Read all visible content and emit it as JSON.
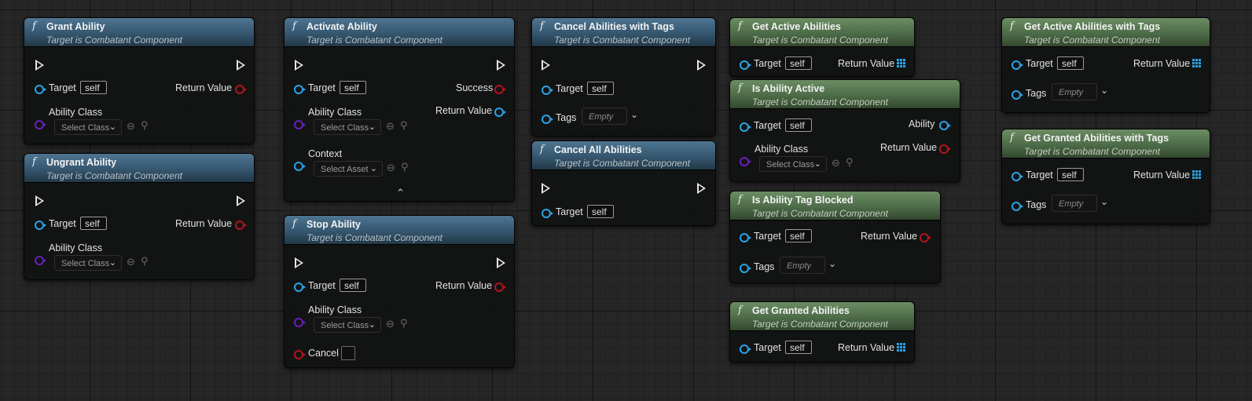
{
  "common": {
    "func_glyph": "f",
    "subtitle": "Target is Combatant Component",
    "target_label": "Target",
    "self_value": "self",
    "return_value_label": "Return Value",
    "ability_class_label": "Ability Class",
    "select_class": "Select Class",
    "select_asset": "Select Asset",
    "tags_label": "Tags",
    "tags_empty": "Empty",
    "chevron_glyph": "⌄",
    "expand_glyph": "⌃",
    "back_glyph": "⊖",
    "search_glyph": "⚲"
  },
  "nodes": {
    "grant": {
      "title": "Grant Ability"
    },
    "ungrant": {
      "title": "Ungrant Ability"
    },
    "activate": {
      "title": "Activate Ability",
      "success_label": "Success",
      "context_label": "Context"
    },
    "stop": {
      "title": "Stop Ability",
      "cancel_label": "Cancel"
    },
    "cancel_tags": {
      "title": "Cancel Abilities with Tags"
    },
    "cancel_all": {
      "title": "Cancel All Abilities"
    },
    "get_active": {
      "title": "Get Active Abilities"
    },
    "is_active": {
      "title": "Is Ability Active",
      "ability_label": "Ability"
    },
    "tag_blocked": {
      "title": "Is Ability Tag Blocked"
    },
    "get_granted": {
      "title": "Get Granted Abilities"
    },
    "get_active_tags": {
      "title": "Get Active Abilities with Tags"
    },
    "get_granted_tags": {
      "title": "Get Granted Abilities with Tags"
    }
  },
  "colors": {
    "blue_header": "#35566f",
    "green_header": "#4d6b48",
    "object_pin": "#2aa3e8",
    "bool_pin": "#b3141b",
    "class_pin": "#6a1fb8"
  },
  "icons": [
    "function-icon",
    "exec-pin-icon",
    "object-pin-icon",
    "bool-pin-icon",
    "class-pin-icon",
    "array-pin-icon",
    "chevron-down-icon",
    "browse-back-icon",
    "search-icon",
    "expand-arrow-icon"
  ]
}
